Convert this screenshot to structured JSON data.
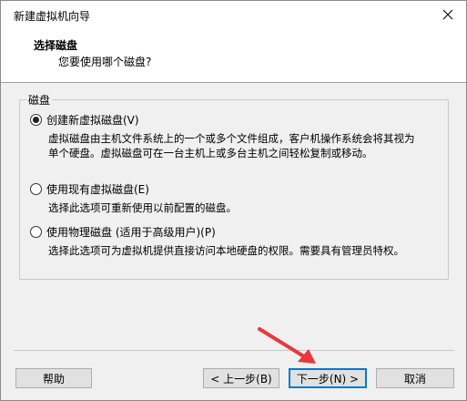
{
  "window": {
    "title": "新建虚拟机向导",
    "close_icon": "close-icon"
  },
  "header": {
    "title": "选择磁盘",
    "subtitle": "您要使用哪个磁盘?"
  },
  "group": {
    "legend": "磁盘",
    "options": [
      {
        "label": "创建新虚拟磁盘(V)",
        "selected": true,
        "description_lines": [
          "虚拟磁盘由主机文件系统上的一个或多个文件组成，客户机操作系统会将其视为",
          "单个硬盘。虚拟磁盘可在一台主机上或多台主机之间轻松复制或移动。"
        ]
      },
      {
        "label": "使用现有虚拟磁盘(E)",
        "selected": false,
        "description_lines": [
          "选择此选项可重新使用以前配置的磁盘。"
        ]
      },
      {
        "label": "使用物理磁盘 (适用于高级用户)(P)",
        "selected": false,
        "description_lines": [
          "选择此选项可为虚拟机提供直接访问本地硬盘的权限。需要具有管理员特权。"
        ]
      }
    ]
  },
  "buttons": {
    "help": "帮助",
    "back": "< 上一步(B)",
    "next": "下一步(N) >",
    "cancel": "取消"
  },
  "colors": {
    "accent": "#0078d7",
    "annotation_arrow": "#e8383d"
  }
}
